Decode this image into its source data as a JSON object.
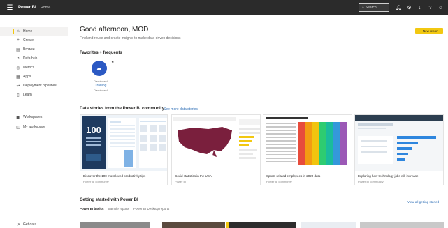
{
  "app": {
    "brand": "Power BI",
    "crumb": "Home",
    "search_placeholder": "Search",
    "top_icons": [
      "bell-icon",
      "gear-icon",
      "download-icon",
      "help-icon",
      "smile-icon"
    ]
  },
  "sidebar": {
    "items": [
      {
        "label": "Home",
        "icon": "⌂"
      },
      {
        "label": "Create",
        "icon": "+"
      },
      {
        "label": "Browse",
        "icon": "▤"
      },
      {
        "label": "Data hub",
        "icon": "◔"
      },
      {
        "label": "Metrics",
        "icon": "◎"
      },
      {
        "label": "Apps",
        "icon": "▦"
      },
      {
        "label": "Deployment pipelines",
        "icon": "⇌"
      },
      {
        "label": "Learn",
        "icon": "▯"
      },
      {
        "label": "Workspaces",
        "icon": "▣"
      },
      {
        "label": "My workspace",
        "icon": "◫"
      }
    ],
    "get_data": "Get data"
  },
  "main": {
    "greeting": "Good afternoon, MOD",
    "subtitle": "Find and reuse and create insights to make data-driven decisions",
    "new_report": "+ New report",
    "favorites_title": "Favorites + frequents",
    "favorite": {
      "kind": "Dashboard",
      "name": "Trading",
      "meta": "Dashboard"
    },
    "stories_title": "Data stories from the Power BI community",
    "stories_link": "See more data stories",
    "stories": [
      {
        "caption": "Discover the 100 most-loved productivity tips",
        "sub": "Power BI community"
      },
      {
        "caption": "Covid statistics in the USA",
        "sub": "Power BI"
      },
      {
        "caption": "Sports-related employees in 2020 data",
        "sub": "Power BI community"
      },
      {
        "caption": "Exploring how technology jobs will increase",
        "sub": "Power BI community"
      }
    ],
    "story_thumb_text": "100",
    "getting_started_title": "Getting started with Power BI",
    "getting_started_link": "View all getting started",
    "tabs": [
      "Power BI basics",
      "Sample reports",
      "Power BI Desktop reports"
    ]
  }
}
